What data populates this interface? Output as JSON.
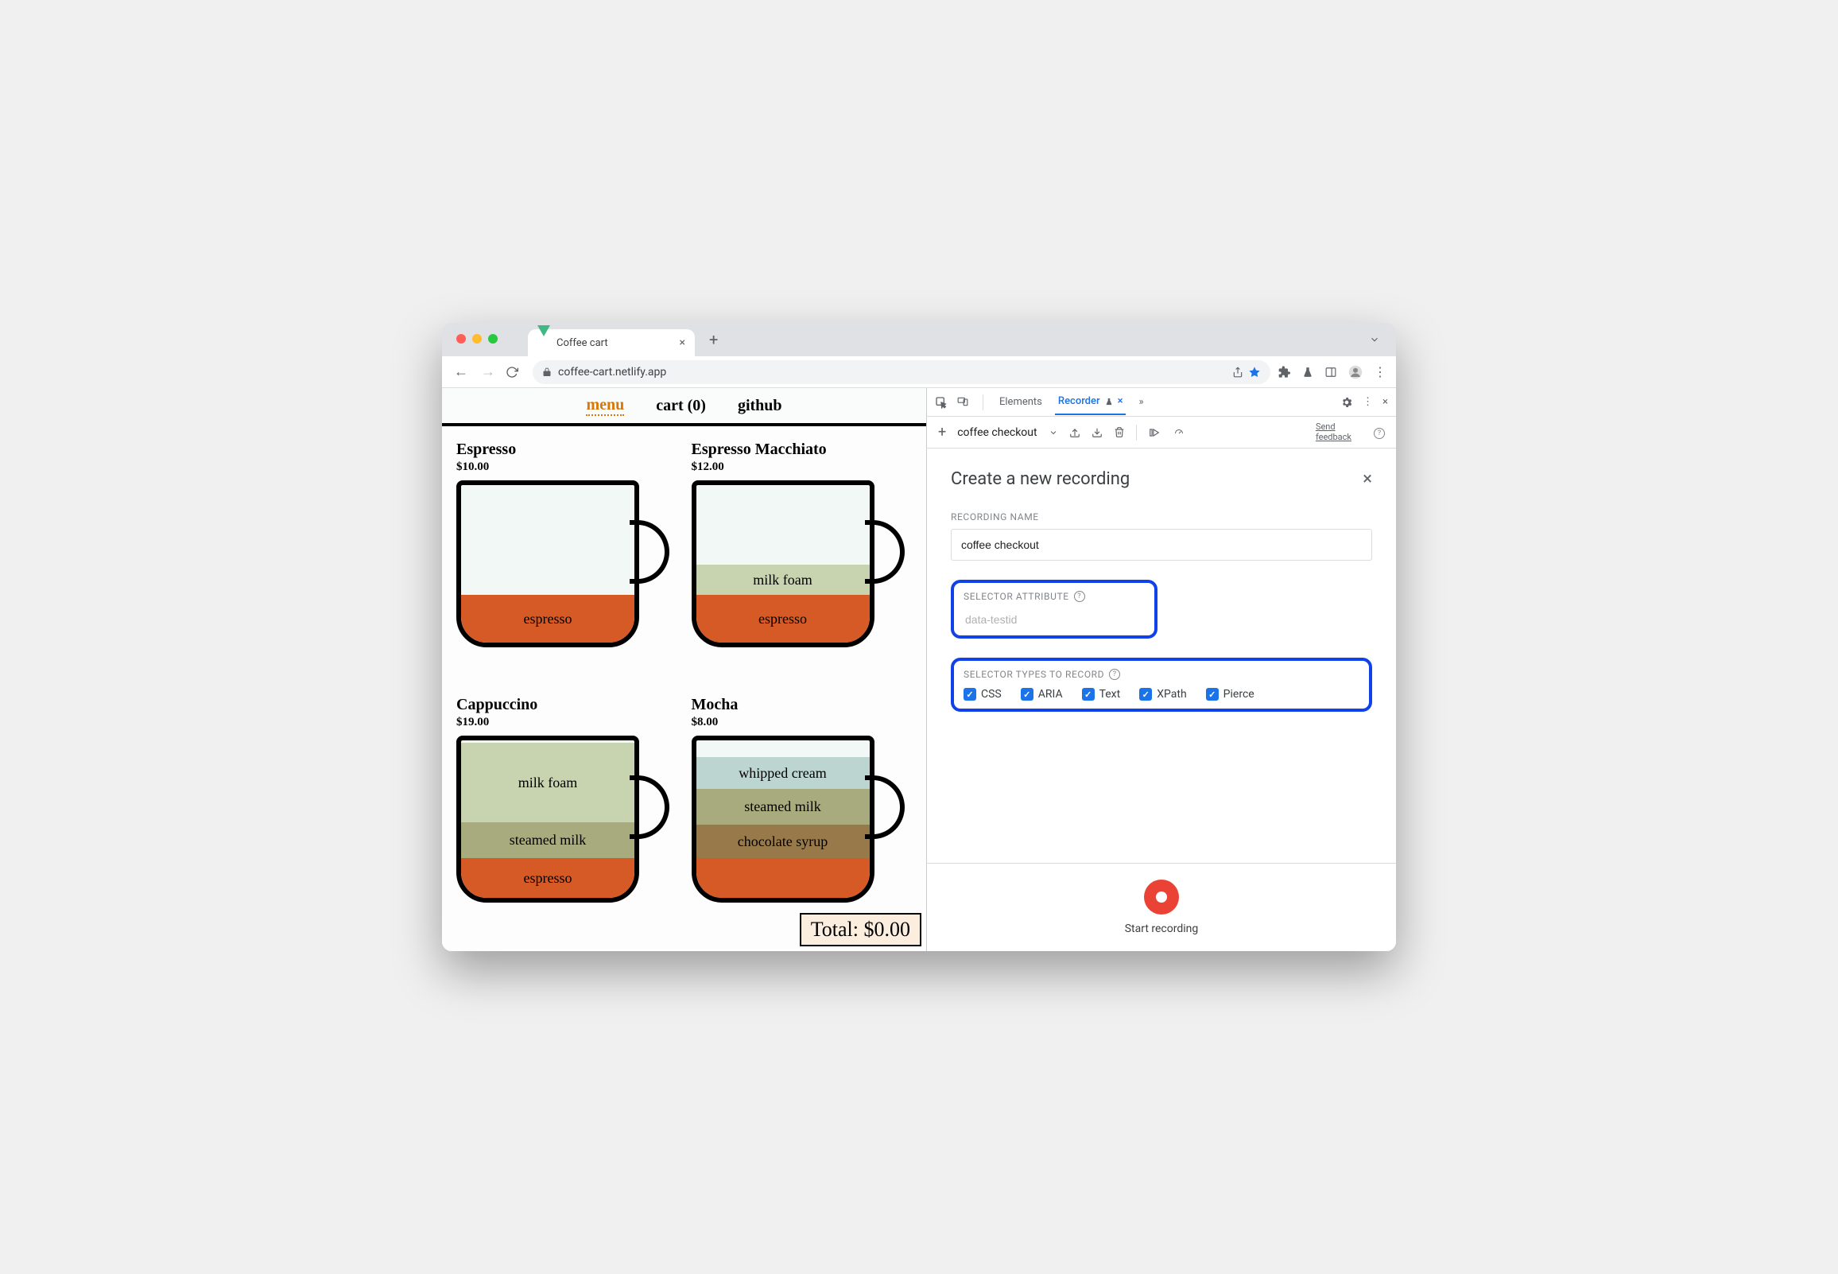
{
  "browser": {
    "tab_title": "Coffee cart",
    "url": "coffee-cart.netlify.app"
  },
  "app": {
    "nav": {
      "menu": "menu",
      "cart": "cart (0)",
      "github": "github"
    },
    "products": [
      {
        "name": "Espresso",
        "price": "$10.00",
        "layers": [
          {
            "cls": "l-espresso",
            "label": "espresso"
          }
        ]
      },
      {
        "name": "Espresso Macchiato",
        "price": "$12.00",
        "layers": [
          {
            "cls": "l-espresso",
            "label": "espresso"
          },
          {
            "cls": "l-milkfoam",
            "label": "milk foam"
          }
        ]
      },
      {
        "name": "Cappuccino",
        "price": "$19.00",
        "layers": [
          {
            "cls": "l-espresso-sm",
            "label": "espresso"
          },
          {
            "cls": "l-steamed",
            "label": "steamed milk"
          },
          {
            "cls": "l-milkfoam-lg",
            "label": "milk foam"
          }
        ]
      },
      {
        "name": "Mocha",
        "price": "$8.00",
        "layers": [
          {
            "cls": "l-espresso-sm",
            "label": ""
          },
          {
            "cls": "l-choco",
            "label": "chocolate syrup"
          },
          {
            "cls": "l-steamed",
            "label": "steamed milk"
          },
          {
            "cls": "l-whipped",
            "label": "whipped cream"
          }
        ]
      }
    ],
    "total": "Total: $0.00"
  },
  "devtools": {
    "tabs": {
      "elements": "Elements",
      "recorder": "Recorder",
      "more": "»"
    },
    "subbar": {
      "flow_name": "coffee checkout",
      "feedback1": "Send",
      "feedback2": "feedback"
    },
    "panel": {
      "title": "Create a new recording",
      "name_label": "RECORDING NAME",
      "name_value": "coffee checkout",
      "attr_label": "SELECTOR ATTRIBUTE",
      "attr_placeholder": "data-testid",
      "types_label": "SELECTOR TYPES TO RECORD",
      "types": [
        "CSS",
        "ARIA",
        "Text",
        "XPath",
        "Pierce"
      ],
      "start": "Start recording"
    }
  }
}
